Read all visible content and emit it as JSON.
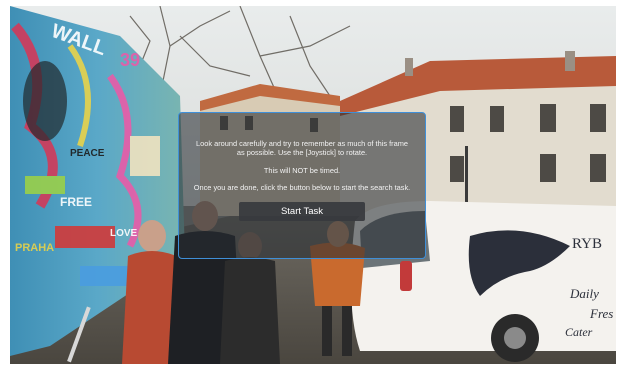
{
  "dialog": {
    "instructions": "Look around carefully and try to remember as much of this frame as possible. Use the [Joystick] to rotate.",
    "timing_note": "This will NOT be timed.",
    "continue_note": "Once you are done, click the button below to start the search task.",
    "start_button": "Start Task",
    "border_color": "#3f8fd8"
  },
  "scene": {
    "wall_graffiti_text": [
      "WALL",
      "39",
      "FREE",
      "PRAHA",
      "LOVE",
      "PEACE"
    ],
    "van_text": [
      "RYB",
      "Daily",
      "Fres",
      "Cater"
    ]
  }
}
